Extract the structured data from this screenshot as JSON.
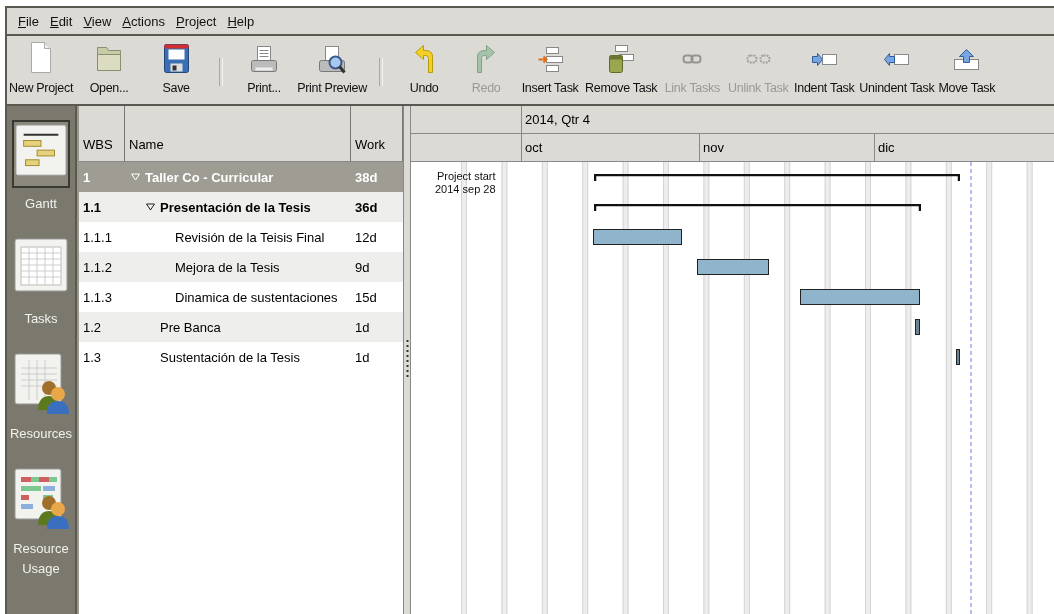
{
  "menu": [
    "File",
    "Edit",
    "View",
    "Actions",
    "Project",
    "Help"
  ],
  "toolbar": [
    {
      "kind": "button",
      "label": "New Project",
      "disabled": false
    },
    {
      "kind": "button",
      "label": "Open...",
      "disabled": false
    },
    {
      "kind": "button",
      "label": "Save",
      "disabled": false
    },
    {
      "kind": "separator"
    },
    {
      "kind": "button",
      "label": "Print...",
      "disabled": false
    },
    {
      "kind": "button",
      "label": "Print Preview",
      "disabled": false
    },
    {
      "kind": "separator"
    },
    {
      "kind": "button",
      "label": "Undo",
      "disabled": false
    },
    {
      "kind": "button",
      "label": "Redo",
      "disabled": true
    },
    {
      "kind": "button",
      "label": "Insert Task",
      "disabled": false
    },
    {
      "kind": "button",
      "label": "Remove Task",
      "disabled": false
    },
    {
      "kind": "button",
      "label": "Link Tasks",
      "disabled": true
    },
    {
      "kind": "button",
      "label": "Unlink Task",
      "disabled": true
    },
    {
      "kind": "button",
      "label": "Indent Task",
      "disabled": false
    },
    {
      "kind": "button",
      "label": "Unindent Task",
      "disabled": false
    },
    {
      "kind": "button",
      "label": "Move Task",
      "disabled": false
    }
  ],
  "sidebar": [
    {
      "label": "Gantt",
      "selected": true
    },
    {
      "label": "Tasks",
      "selected": false
    },
    {
      "label": "Resources",
      "selected": false
    },
    {
      "label": "Resource Usage",
      "selected": false
    }
  ],
  "table": {
    "columns": [
      "WBS",
      "Name",
      "Work"
    ],
    "rows": [
      {
        "wbs": "1",
        "name": "Taller Co - Curricular",
        "work": "38d",
        "selected": true,
        "expanded": true,
        "children": [
          {
            "wbs": "1.1",
            "name": "Presentación de la Tesis",
            "work": "36d",
            "selected": false,
            "expanded": true,
            "children": [
              {
                "wbs": "1.1.1",
                "name": "Revisión de la Teisis Final",
                "work": "12d",
                "selected": false
              },
              {
                "wbs": "1.1.2",
                "name": "Mejora de la Tesis",
                "work": "9d",
                "selected": false
              },
              {
                "wbs": "1.1.3",
                "name": "Dinamica de sustentaciones",
                "work": "15d",
                "selected": false
              }
            ]
          },
          {
            "wbs": "1.2",
            "name": "Pre Banca",
            "work": "1d",
            "selected": false
          },
          {
            "wbs": "1.3",
            "name": "Sustentación de la Tesis",
            "work": "1d",
            "selected": false
          }
        ]
      }
    ]
  },
  "gantt": {
    "quarter": "2014, Qtr 4",
    "months": [
      "oct",
      "nov",
      "dic"
    ],
    "project_start": {
      "label": "Project start",
      "date": "2014 sep 28"
    }
  }
}
